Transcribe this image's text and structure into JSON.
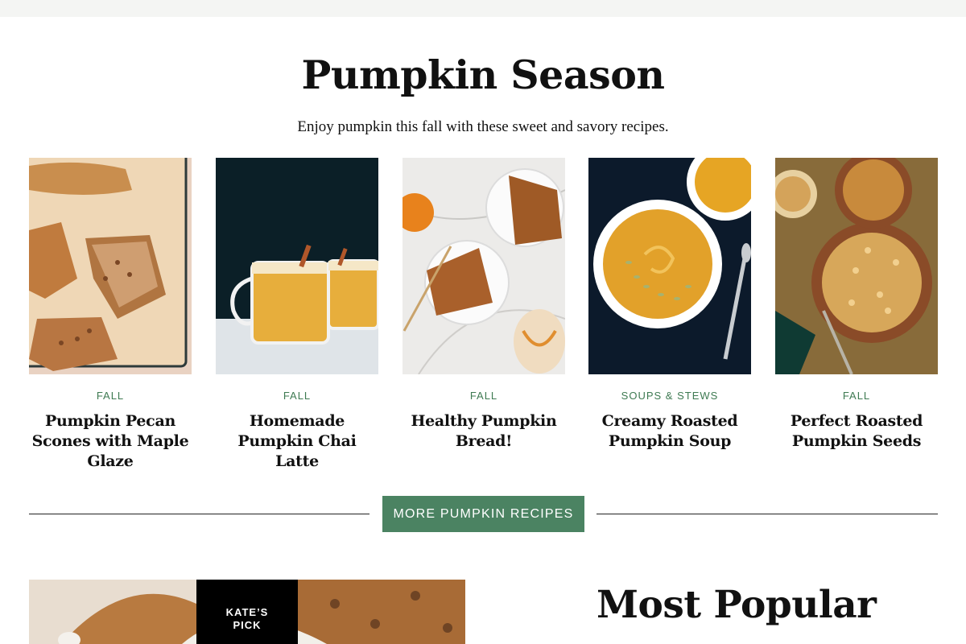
{
  "section": {
    "title": "Pumpkin Season",
    "subtitle": "Enjoy pumpkin this fall with these sweet and savory recipes."
  },
  "recipes": [
    {
      "category": "Fall",
      "title": "Pumpkin Pecan Scones with Maple Glaze"
    },
    {
      "category": "Fall",
      "title": "Homemade Pumpkin Chai Latte"
    },
    {
      "category": "Fall",
      "title": "Healthy Pumpkin Bread!"
    },
    {
      "category": "Soups & Stews",
      "title": "Creamy Roasted Pumpkin Soup"
    },
    {
      "category": "Fall",
      "title": "Perfect Roasted Pumpkin Seeds"
    }
  ],
  "more_button": {
    "label": "More Pumpkin Recipes"
  },
  "featured": {
    "badge_line1": "KATE’S",
    "badge_line2": "PICK"
  },
  "popular": {
    "title": "Most Popular"
  },
  "colors": {
    "accent": "#4b8362",
    "category_text": "#3e7a52"
  }
}
